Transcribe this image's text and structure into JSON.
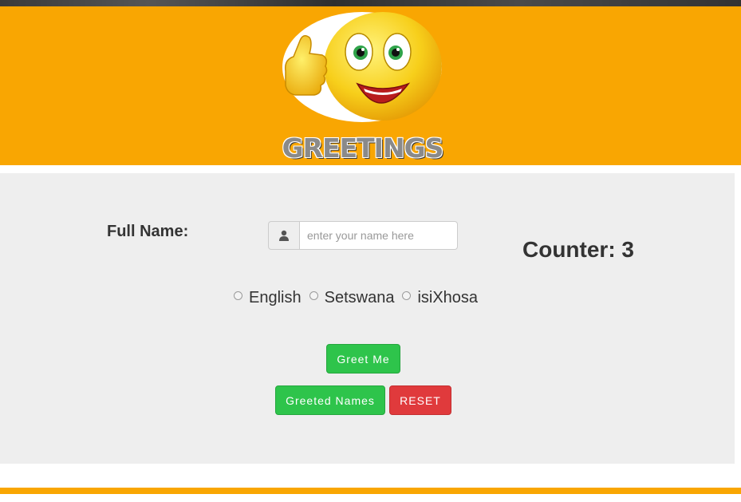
{
  "header": {
    "title": "GREETINGS",
    "logo_icon": "thumbs-up-smiley-icon",
    "background_color": "#f9a602"
  },
  "form": {
    "fullname_label": "Full Name:",
    "name_input": {
      "value": "",
      "placeholder": "enter your name here",
      "icon": "user-icon"
    },
    "counter_label": "Counter: 3",
    "languages": [
      {
        "label": "English",
        "checked": false
      },
      {
        "label": "Setswana",
        "checked": false
      },
      {
        "label": "isiXhosa",
        "checked": false
      }
    ]
  },
  "buttons": {
    "greet": "Greet Me",
    "greeted_names": "Greeted Names",
    "reset": "RESET",
    "green_color": "#2ec44b",
    "red_color": "#e03a3c"
  }
}
